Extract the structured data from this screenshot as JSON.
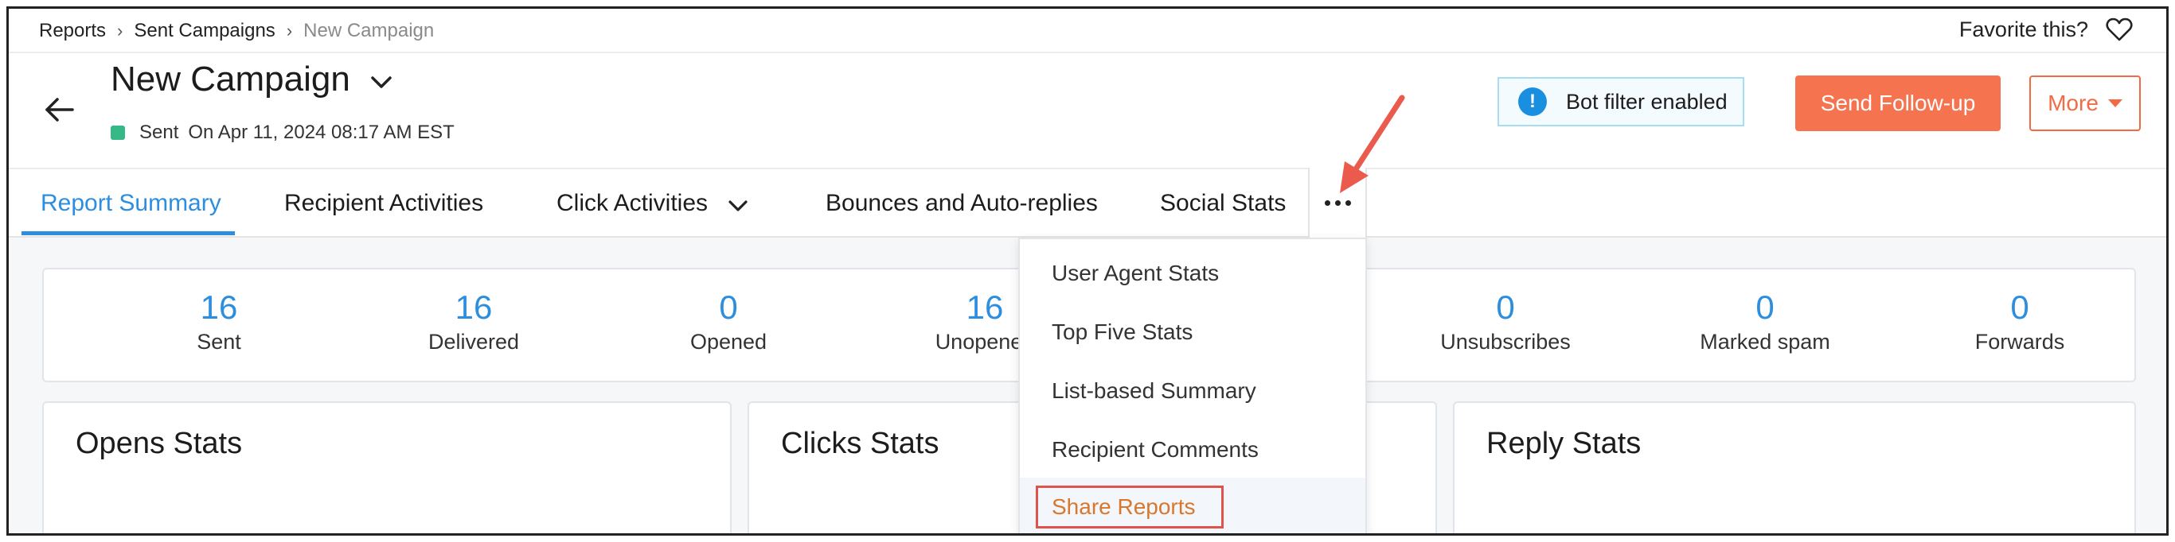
{
  "breadcrumb": {
    "items": [
      "Reports",
      "Sent Campaigns",
      "New Campaign"
    ]
  },
  "favorite": {
    "label": "Favorite this?",
    "icon": "heart-outline-icon"
  },
  "header": {
    "title": "New Campaign",
    "status_label": "Sent",
    "status_time": "On Apr 11, 2024 08:17 AM EST",
    "status_color": "#37b887",
    "bot_filter": "Bot filter enabled",
    "follow_up_label": "Send Follow-up",
    "more_label": "More"
  },
  "tabs": [
    {
      "label": "Report Summary",
      "active": true
    },
    {
      "label": "Recipient Activities"
    },
    {
      "label": "Click Activities",
      "dropdown": true
    },
    {
      "label": "Bounces and Auto-replies"
    },
    {
      "label": "Social Stats"
    }
  ],
  "stats": [
    {
      "value": "16",
      "label": "Sent"
    },
    {
      "value": "16",
      "label": "Delivered"
    },
    {
      "value": "0",
      "label": "Opened"
    },
    {
      "value": "16",
      "label": "Unopened"
    },
    {
      "value": "0",
      "label": "Unsubscribes"
    },
    {
      "value": "0",
      "label": "Marked spam"
    },
    {
      "value": "0",
      "label": "Forwards"
    }
  ],
  "panels": [
    {
      "title": "Opens Stats"
    },
    {
      "title": "Clicks Stats"
    },
    {
      "title": "Reply Stats"
    }
  ],
  "more_menu": [
    {
      "label": "User Agent Stats"
    },
    {
      "label": "Top Five Stats"
    },
    {
      "label": "List-based Summary"
    },
    {
      "label": "Recipient Comments"
    },
    {
      "label": "Share Reports",
      "highlighted": true
    }
  ],
  "colors": {
    "accent_blue": "#2d8ee0",
    "brand_orange": "#f5734e",
    "highlight_red": "#e0524c"
  }
}
